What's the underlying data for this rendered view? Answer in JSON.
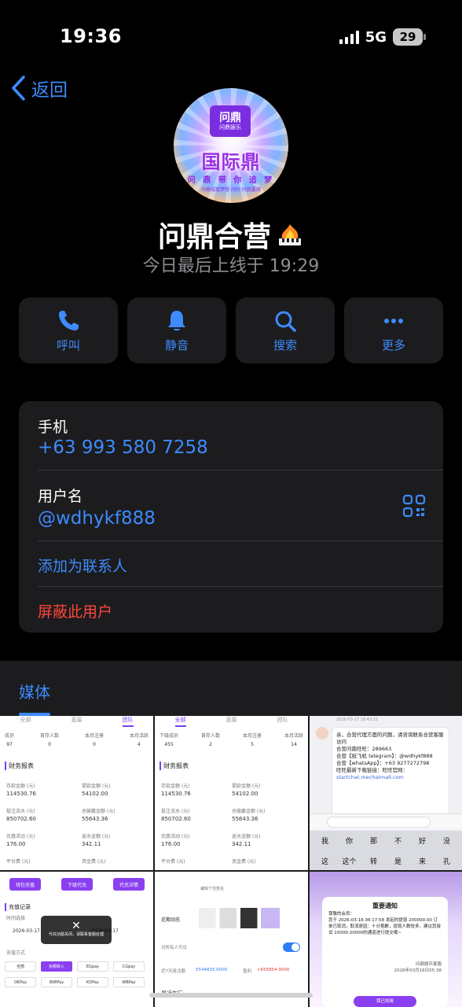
{
  "status_bar": {
    "time": "19:36",
    "network": "5G",
    "battery": "29"
  },
  "nav": {
    "back_label": "返回"
  },
  "avatar": {
    "logo_line1": "问鼎",
    "logo_line2": "问鼎娱乐",
    "big_text": "国际鼎",
    "slogan": "问 鼎 带 你 追 梦",
    "tiny_text": "问鼎成就梦想  问问  问我要做"
  },
  "profile": {
    "name": "问鼎合营",
    "last_seen": "今日最后上线于 19:29"
  },
  "actions": [
    {
      "label": "呼叫",
      "icon": "phone-icon"
    },
    {
      "label": "静音",
      "icon": "bell-icon"
    },
    {
      "label": "搜索",
      "icon": "search-icon"
    },
    {
      "label": "更多",
      "icon": "more-icon"
    }
  ],
  "info": {
    "phone_label": "手机",
    "phone_value": "+63 993 580 7258",
    "username_label": "用户名",
    "username_value": "@wdhykf888",
    "add_contact": "添加为联系人",
    "block_user": "屏蔽此用户"
  },
  "media": {
    "title": "媒体"
  },
  "thumbs": {
    "report_tabs": [
      "全部",
      "直属",
      "团队"
    ],
    "report1_stats": [
      {
        "k": "成员",
        "v": "97"
      },
      {
        "k": "首存人数",
        "v": "0"
      },
      {
        "k": "本月注册",
        "v": "0"
      },
      {
        "k": "本月活跃",
        "v": "4"
      }
    ],
    "report2_stats": [
      {
        "k": "下级成员",
        "v": "455"
      },
      {
        "k": "首存人数",
        "v": "2"
      },
      {
        "k": "本月注册",
        "v": "5"
      },
      {
        "k": "本月活跃",
        "v": "14"
      }
    ],
    "report_section": "财务报表",
    "report_kv": [
      {
        "k": "存款金额 (元)",
        "v": "114530.76"
      },
      {
        "k": "提款金额 (元)",
        "v": "54102.00"
      },
      {
        "k": "投注流水 (元)",
        "v": "850702.60"
      },
      {
        "k": "总输赢金额 (元)",
        "v": "55643.36"
      },
      {
        "k": "优惠活动 (元)",
        "v": "176.00"
      },
      {
        "k": "返水金额 (元)",
        "v": "342.11"
      },
      {
        "k": "平台费 (元)",
        "v": ""
      },
      {
        "k": "资金费 (元)",
        "v": ""
      }
    ],
    "chat": {
      "time": "2026-03-17 18:43:21",
      "lines": [
        "亲，合营代理方面的问题，请咨询联系合营客服访问",
        "",
        "合营问鼎旺旺：289663",
        "合营【纸飞机 telegram】：@wdhykf888",
        "合营【whatsApp】：+63 9277272798",
        "",
        "旺旺最新下载链接：旺旺官网："
      ],
      "link": "startchat.mechatmall.com",
      "keys": [
        "我",
        "你",
        "那",
        "不",
        "好",
        "没",
        "这",
        "这个",
        "转",
        "是",
        "来",
        "孔"
      ]
    },
    "recharge": {
      "buttons": [
        "钱包充值",
        "下级代充",
        "代充详情"
      ],
      "section": "充值记录",
      "time_label": "时间选择",
      "date_from": "2026-03-17",
      "date_to": "2026-03-17",
      "toast": "代充功能关闭，请联系客服处理",
      "method_label": "充值方式",
      "chips": [
        "全部",
        "余额转入",
        "EGpay",
        "CGpay",
        "OKPay",
        "808Pay",
        "KDPay",
        "WBPay"
      ]
    },
    "activity": {
      "edit_label": "编辑个性签名",
      "recent": "近期动态",
      "visible": "对所有人可见",
      "bet_label": "近7天投注额",
      "bet_value": "5544835.6000",
      "profit_label": "盈利",
      "profit_value": "+655854.9000",
      "recent_play": "最近在玩"
    },
    "notice": {
      "title": "重要通知",
      "salutation": "尊敬的会员：",
      "body": "您于 2026-03-16 06:17:58 发起的提现 200000.00 订单已取消，取消原因：十分抱歉，提现人数较多，建议您尝试 10000-20000的通道进行提交哦~",
      "brand": "问鼎娱乐客服",
      "date": "2026年03月16日05:38",
      "button": "我已知晓"
    }
  }
}
